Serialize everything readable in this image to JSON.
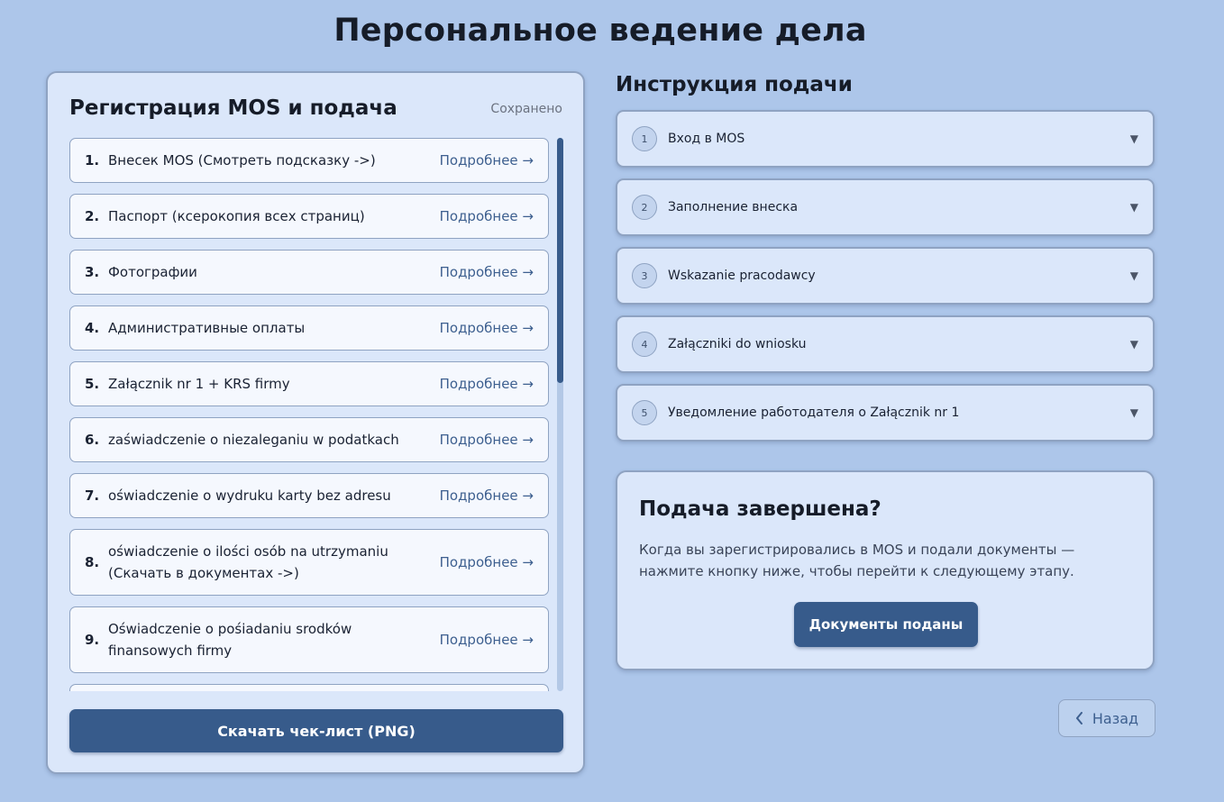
{
  "page": {
    "title": "Персональное ведение дела"
  },
  "checklist": {
    "title": "Регистрация MOS и подача",
    "status": "Сохранено",
    "items": [
      {
        "num": "1.",
        "text": "Внесек MOS (Смотреть подсказку ->)",
        "more": "Подробнее →"
      },
      {
        "num": "2.",
        "text": "Паспорт (ксерокопия всех страниц)",
        "more": "Подробнее →"
      },
      {
        "num": "3.",
        "text": "Фотографии",
        "more": "Подробнее →"
      },
      {
        "num": "4.",
        "text": "Административные оплаты",
        "more": "Подробнее →"
      },
      {
        "num": "5.",
        "text": "Załącznik nr 1 + KRS firmy",
        "more": "Подробнее →"
      },
      {
        "num": "6.",
        "text": "zaświadczenie o niezaleganiu w podatkach",
        "more": "Подробнее →"
      },
      {
        "num": "7.",
        "text": "oświadczenie o wydruku karty bez adresu",
        "more": "Подробнее →"
      },
      {
        "num": "8.",
        "text": "oświadczenie o ilości osób na utrzymaniu (Скачать в документах ->)",
        "more": "Подробнее →"
      },
      {
        "num": "9.",
        "text": "Oświadczenie o pośiadaniu srodków finansowych firmy",
        "more": "Подробнее →"
      }
    ],
    "download_label": "Скачать чек-лист (PNG)"
  },
  "instructions": {
    "title": "Инструкция подачи",
    "steps": [
      {
        "num": "1",
        "label": "Вход в MOS"
      },
      {
        "num": "2",
        "label": "Заполнение внеска"
      },
      {
        "num": "3",
        "label": "Wskazanie pracodawcy"
      },
      {
        "num": "4",
        "label": "Załączniki do wniosku"
      },
      {
        "num": "5",
        "label": "Уведомление работодателя о Załącznik nr 1"
      }
    ],
    "chevron": "▼"
  },
  "completion": {
    "title": "Подача завершена?",
    "text": "Когда вы зарегистрировались в MOS и подали документы — нажмите кнопку ниже, чтобы перейти к следующему этапу.",
    "button_label": "Документы поданы"
  },
  "navigation": {
    "back_label": "Назад"
  },
  "colors": {
    "background": "#adc6ea",
    "card": "#dbe7fa",
    "primary": "#375b8b",
    "link": "#3d5f8f"
  }
}
